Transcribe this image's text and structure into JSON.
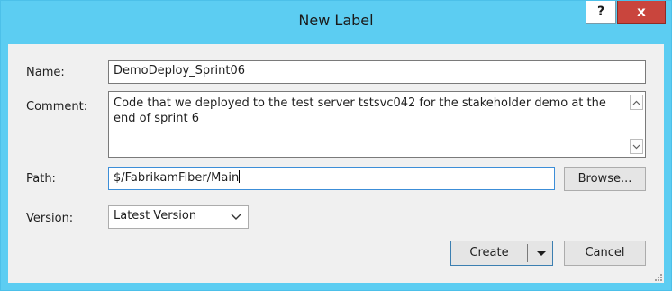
{
  "dialog": {
    "title": "New Label",
    "help_label": "?",
    "close_label": "x"
  },
  "form": {
    "name_label": "Name:",
    "name_value": "DemoDeploy_Sprint06",
    "comment_label": "Comment:",
    "comment_value": "Code that we deployed to the test server tstsvc042 for the stakeholder demo at the end of sprint 6",
    "path_label": "Path:",
    "path_value": "$/FabrikamFiber/Main",
    "browse_label": "Browse...",
    "version_label": "Version:",
    "version_value": "Latest Version"
  },
  "actions": {
    "create_label": "Create",
    "cancel_label": "Cancel"
  },
  "colors": {
    "titlebar": "#5ccdf2",
    "close_button": "#c9453d",
    "client_background": "#f0f0f0"
  },
  "icons": [
    "help-icon",
    "close-icon",
    "chevron-up-icon",
    "chevron-down-icon",
    "dropdown-arrow-icon",
    "resize-grip-icon"
  ]
}
